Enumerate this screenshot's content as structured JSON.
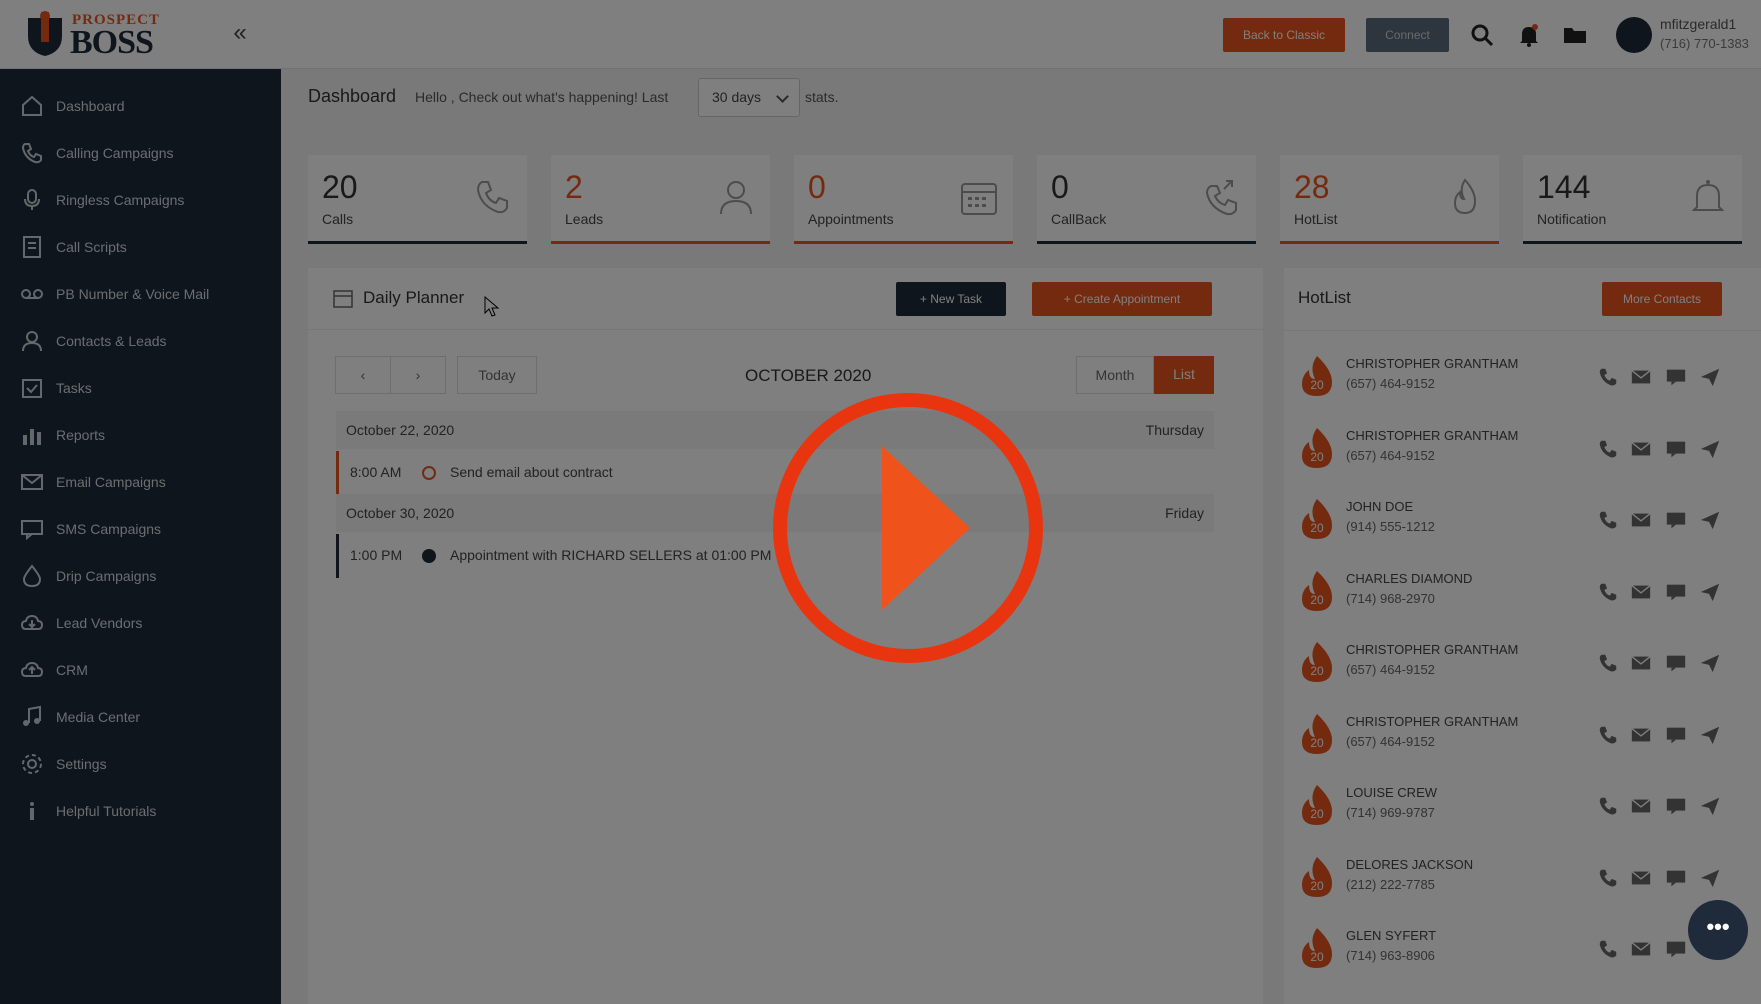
{
  "brand": {
    "logo_top": "PROSPECT",
    "logo_bottom": "BOSS"
  },
  "topbar": {
    "back_to_classic": "Back to Classic",
    "connect": "Connect",
    "user_name": "mfitzgerald1",
    "user_phone": "(716) 770-1383"
  },
  "sidebar": {
    "items": [
      {
        "label": "Dashboard",
        "icon": "home-icon"
      },
      {
        "label": "Calling Campaigns",
        "icon": "phone-icon"
      },
      {
        "label": "Ringless Campaigns",
        "icon": "microphone-icon"
      },
      {
        "label": "Call Scripts",
        "icon": "script-icon"
      },
      {
        "label": "PB Number & Voice Mail",
        "icon": "voicemail-icon"
      },
      {
        "label": "Contacts & Leads",
        "icon": "user-icon"
      },
      {
        "label": "Tasks",
        "icon": "tasks-icon"
      },
      {
        "label": "Reports",
        "icon": "chart-icon"
      },
      {
        "label": "Email Campaigns",
        "icon": "mail-icon"
      },
      {
        "label": "SMS Campaigns",
        "icon": "sms-icon"
      },
      {
        "label": "Drip Campaigns",
        "icon": "drip-icon"
      },
      {
        "label": "Lead Vendors",
        "icon": "cloud-download-icon"
      },
      {
        "label": "CRM",
        "icon": "cloud-upload-icon"
      },
      {
        "label": "Media Center",
        "icon": "music-icon"
      },
      {
        "label": "Settings",
        "icon": "gear-icon"
      },
      {
        "label": "Helpful Tutorials",
        "icon": "info-icon"
      }
    ]
  },
  "header": {
    "title": "Dashboard",
    "subtitle": "Hello , Check out what's happening! Last",
    "range_value": "30 days",
    "after": "stats."
  },
  "stats": [
    {
      "value": "20",
      "label": "Calls",
      "accent": false,
      "icon": "phone-icon"
    },
    {
      "value": "2",
      "label": "Leads",
      "accent": true,
      "icon": "user-icon"
    },
    {
      "value": "0",
      "label": "Appointments",
      "accent": true,
      "icon": "calendar-icon"
    },
    {
      "value": "0",
      "label": "CallBack",
      "accent": false,
      "icon": "callback-icon"
    },
    {
      "value": "28",
      "label": "HotList",
      "accent": true,
      "icon": "flame-icon"
    },
    {
      "value": "144",
      "label": "Notification",
      "accent": false,
      "icon": "bell-icon"
    }
  ],
  "planner": {
    "title": "Daily Planner",
    "new_task": "+ New Task",
    "create_appointment": "+ Create Appointment",
    "prev": "‹",
    "next": "›",
    "today": "Today",
    "month_title": "OCTOBER 2020",
    "view_month": "Month",
    "view_list": "List",
    "days": [
      {
        "date": "October 22, 2020",
        "weekday": "Thursday",
        "event": {
          "time": "8:00 AM",
          "text": "Send email about contract"
        }
      },
      {
        "date": "October 30, 2020",
        "weekday": "Friday",
        "event": {
          "time": "1:00 PM",
          "text": "Appointment with RICHARD SELLERS at 01:00 PM"
        }
      }
    ]
  },
  "hotlist": {
    "title": "HotList",
    "more": "More Contacts",
    "badge": "20",
    "rows": [
      {
        "name": "CHRISTOPHER GRANTHAM",
        "phone": "(657) 464-9152"
      },
      {
        "name": "CHRISTOPHER GRANTHAM",
        "phone": "(657) 464-9152"
      },
      {
        "name": "John Doe",
        "phone": "(914) 555-1212"
      },
      {
        "name": "CHARLES DIAMOND",
        "phone": "(714) 968-2970"
      },
      {
        "name": "CHRISTOPHER GRANTHAM",
        "phone": "(657) 464-9152"
      },
      {
        "name": "CHRISTOPHER GRANTHAM",
        "phone": "(657) 464-9152"
      },
      {
        "name": "LOUISE CREW",
        "phone": "(714) 969-9787"
      },
      {
        "name": "DELORES JACKSON",
        "phone": "(212) 222-7785"
      },
      {
        "name": "GLEN SYFERT",
        "phone": "(714) 963-8906"
      }
    ]
  },
  "colors": {
    "accent": "#e8551e",
    "navy": "#1f2a3b",
    "play": "#e8350f"
  },
  "fab": "•••"
}
